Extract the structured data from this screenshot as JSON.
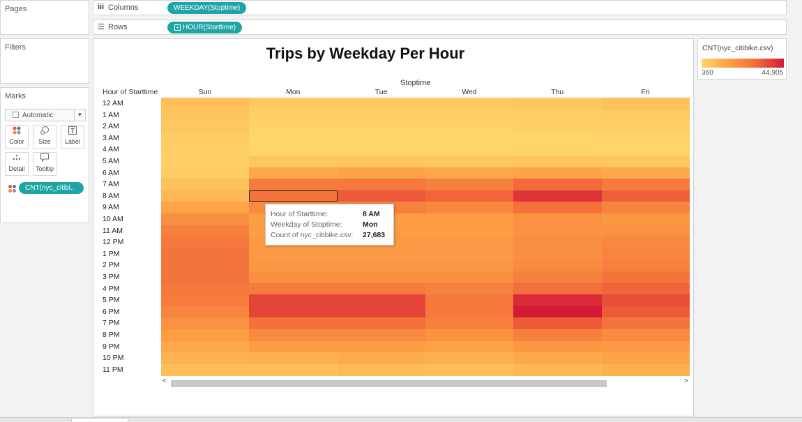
{
  "pages": {
    "title": "Pages"
  },
  "filters": {
    "title": "Filters"
  },
  "marks": {
    "title": "Marks",
    "mark_type": "Automatic",
    "buttons": [
      {
        "label": "Color",
        "icon": "color-icon"
      },
      {
        "label": "Size",
        "icon": "size-icon"
      },
      {
        "label": "Label",
        "icon": "label-icon"
      },
      {
        "label": "Detail",
        "icon": "detail-icon"
      },
      {
        "label": "Tooltip",
        "icon": "tooltip-icon"
      }
    ],
    "color_pill": "CNT(nyc_citibi.."
  },
  "columns_shelf": {
    "label": "Columns",
    "pill": "WEEKDAY(Stoptime)"
  },
  "rows_shelf": {
    "label": "Rows",
    "pill": "HOUR(Starttime)"
  },
  "view": {
    "title": "Trips by Weekday Per Hour",
    "column_header": "Stoptime",
    "row_header": "Hour of Starttime",
    "selected": {
      "hour_index": 8,
      "day_index": 1
    }
  },
  "tooltip": {
    "rows": [
      {
        "key": "Hour of Starttime:",
        "value": "8 AM"
      },
      {
        "key": "Weekday of Stoptime:",
        "value": "Mon"
      },
      {
        "key": "Count of nyc_citibike.csv:",
        "value": "27,683"
      }
    ]
  },
  "legend": {
    "title": "CNT(nyc_citibike.csv)",
    "min_label": "360",
    "max_label": "44,905",
    "colors": [
      "#fed76a",
      "#fda045",
      "#f26a3a",
      "#d21a37"
    ]
  },
  "chart_data": {
    "type": "heatmap",
    "title": "Trips by Weekday Per Hour",
    "xlabel": "Stoptime",
    "ylabel": "Hour of Starttime",
    "x": [
      "Sun",
      "Mon",
      "Tue",
      "Wed",
      "Thu",
      "Fri"
    ],
    "y": [
      "12 AM",
      "1 AM",
      "2 AM",
      "3 AM",
      "4 AM",
      "5 AM",
      "6 AM",
      "7 AM",
      "8 AM",
      "9 AM",
      "10 AM",
      "11 AM",
      "12 PM",
      "1 PM",
      "2 PM",
      "3 PM",
      "4 PM",
      "5 PM",
      "6 PM",
      "7 PM",
      "8 PM",
      "9 PM",
      "10 PM",
      "11 PM"
    ],
    "color_range": [
      360,
      44905
    ],
    "values": [
      [
        7000,
        4000,
        4000,
        4000,
        4500,
        6000
      ],
      [
        5500,
        2500,
        2500,
        2500,
        3000,
        3500
      ],
      [
        4500,
        1500,
        1500,
        1500,
        2000,
        2500
      ],
      [
        3500,
        1000,
        1000,
        1000,
        1200,
        1500
      ],
      [
        3000,
        800,
        800,
        800,
        1000,
        1200
      ],
      [
        2500,
        5000,
        5000,
        5000,
        5500,
        5000
      ],
      [
        3500,
        13000,
        14000,
        13000,
        14000,
        13000
      ],
      [
        6000,
        25000,
        26000,
        24000,
        30000,
        25000
      ],
      [
        9000,
        27683,
        33000,
        31000,
        40000,
        32000
      ],
      [
        14000,
        21000,
        24000,
        22000,
        28000,
        23000
      ],
      [
        20000,
        16000,
        16000,
        16000,
        19000,
        18000
      ],
      [
        24000,
        16000,
        16000,
        16000,
        19000,
        19000
      ],
      [
        26000,
        17000,
        17000,
        17000,
        20000,
        22000
      ],
      [
        27000,
        17000,
        17000,
        17000,
        20000,
        23000
      ],
      [
        27000,
        18000,
        18000,
        18000,
        21000,
        24000
      ],
      [
        27000,
        20000,
        20000,
        20000,
        24000,
        27000
      ],
      [
        26000,
        25000,
        25000,
        24000,
        29000,
        31000
      ],
      [
        25000,
        37000,
        37000,
        26000,
        42000,
        35000
      ],
      [
        23000,
        37000,
        37000,
        26000,
        44905,
        33000
      ],
      [
        19000,
        28000,
        28000,
        24000,
        33000,
        27000
      ],
      [
        16000,
        21000,
        21000,
        19000,
        24000,
        21000
      ],
      [
        13000,
        16000,
        16000,
        15000,
        18000,
        17000
      ],
      [
        10000,
        11000,
        12000,
        11000,
        13000,
        14000
      ],
      [
        7000,
        7000,
        8000,
        7000,
        9000,
        11000
      ]
    ]
  }
}
